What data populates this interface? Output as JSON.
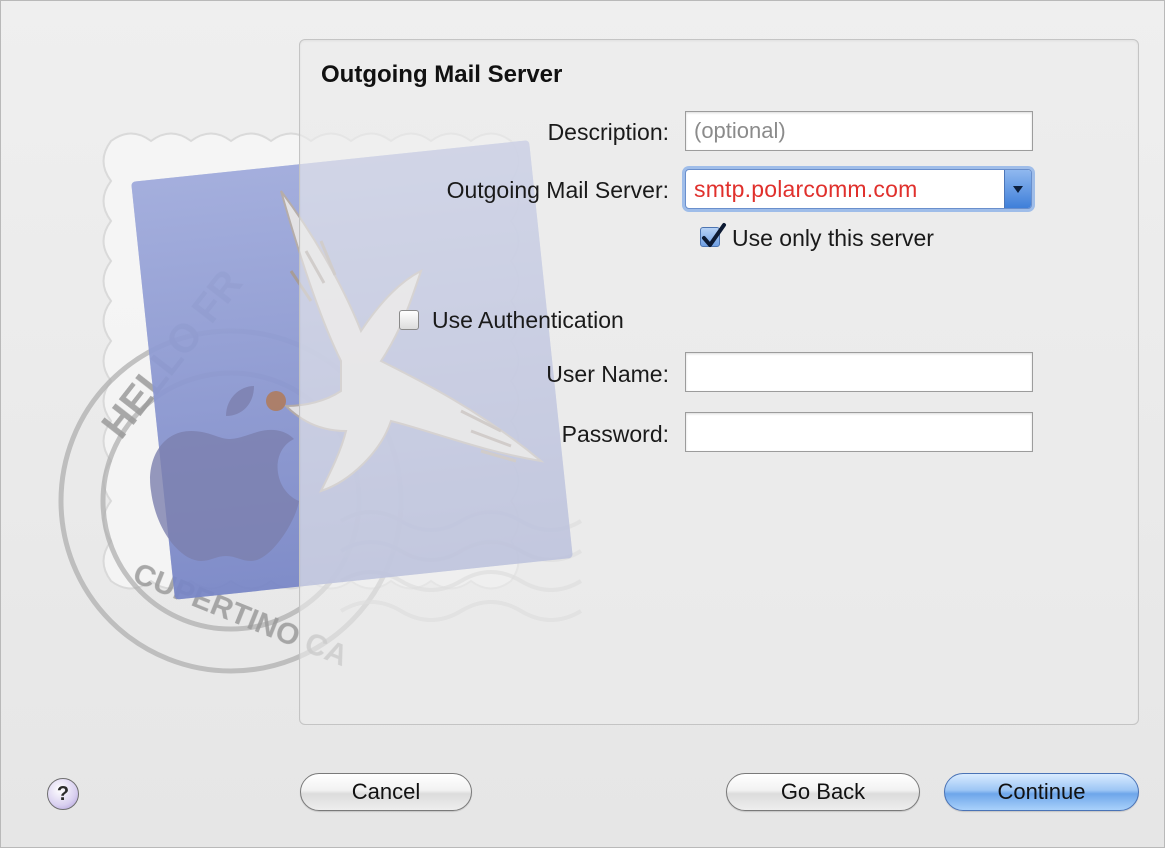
{
  "panel": {
    "title": "Outgoing Mail Server"
  },
  "stamp": {
    "postmark_top": "HELLO FR",
    "postmark_bottom": "CUPERTINO CA"
  },
  "form": {
    "description_label": "Description:",
    "description_placeholder": "(optional)",
    "description_value": "",
    "server_label": "Outgoing Mail Server:",
    "server_value": "smtp.polarcomm.com",
    "use_only_label": "Use only this server",
    "use_only_checked": true,
    "use_auth_label": "Use Authentication",
    "use_auth_checked": false,
    "username_label": "User Name:",
    "username_value": "",
    "password_label": "Password:",
    "password_value": ""
  },
  "buttons": {
    "help": "?",
    "cancel": "Cancel",
    "go_back": "Go Back",
    "continue": "Continue"
  },
  "colors": {
    "server_text": "#e0302c",
    "accent": "#4a8ae0"
  }
}
